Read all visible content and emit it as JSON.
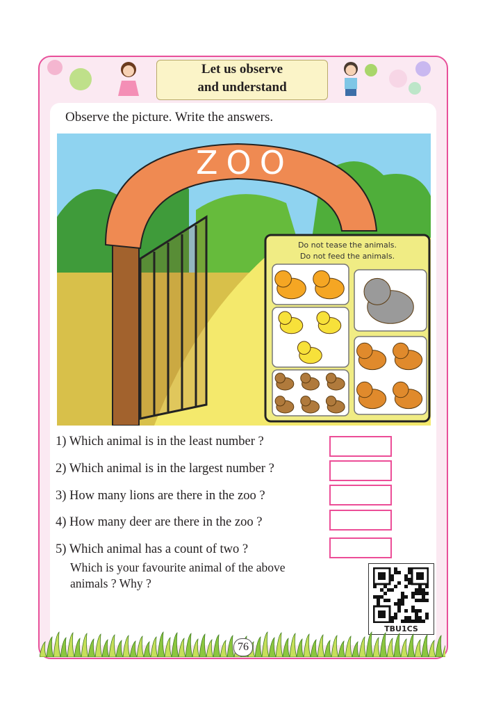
{
  "header": {
    "title_line1": "Let us observe",
    "title_line2": "and understand"
  },
  "instruction": "Observe the picture. Write the answers.",
  "scene": {
    "arch_text": "ZOO",
    "sign_line1": "Do not tease the animals.",
    "sign_line2": "Do not feed the animals.",
    "animals": [
      {
        "name": "lion",
        "count": 2,
        "color": "#f5a623"
      },
      {
        "name": "tiger",
        "count": 3,
        "color": "#f7e13a"
      },
      {
        "name": "monkey",
        "count": 6,
        "color": "#b07a3c"
      },
      {
        "name": "elephant",
        "count": 1,
        "color": "#9a9a9a"
      },
      {
        "name": "deer",
        "count": 4,
        "color": "#e08a2c"
      }
    ]
  },
  "questions": [
    {
      "number": "1)",
      "text": "Which animal is in the least number ?",
      "answer": ""
    },
    {
      "number": "2)",
      "text": "Which animal is  in the largest number ?",
      "answer": ""
    },
    {
      "number": "3)",
      "text": "How many lions are there in the zoo ?",
      "answer": ""
    },
    {
      "number": "4)",
      "text": "How many deer are there in the zoo ?",
      "answer": ""
    },
    {
      "number": "5)",
      "text": "Which animal has a count of two ?",
      "answer": ""
    }
  ],
  "extra_question_line1": "Which is your favourite animal of the above",
  "extra_question_line2": "animals ? Why ?",
  "qr_code": {
    "label": "TBU1CS"
  },
  "page_number": "76",
  "colors": {
    "border": "#e8509a",
    "answer_box": "#ec4d97",
    "sky": "#8fd3f0",
    "arch": "#ef8a52"
  }
}
